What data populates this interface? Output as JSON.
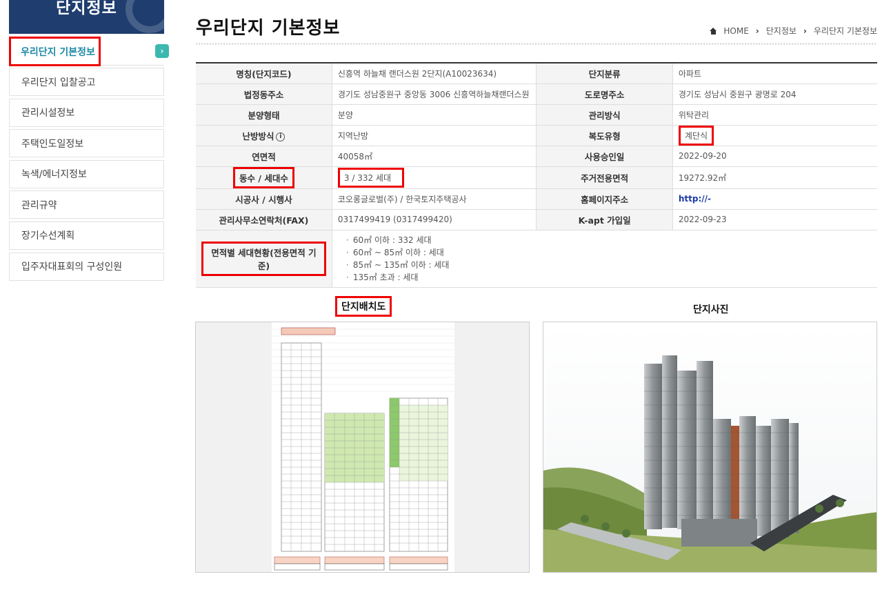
{
  "sidebar": {
    "header": "단지정보",
    "items": [
      {
        "label": "우리단지 기본정보",
        "active": true
      },
      {
        "label": "우리단지 입찰공고"
      },
      {
        "label": "관리시설정보"
      },
      {
        "label": "주택인도일정보"
      },
      {
        "label": "녹색/에너지정보"
      },
      {
        "label": "관리규약"
      },
      {
        "label": "장기수선계획"
      },
      {
        "label": "입주자대표회의 구성인원"
      }
    ],
    "badge": "›"
  },
  "page": {
    "title": "우리단지 기본정보",
    "breadcrumb": [
      "HOME",
      "단지정보",
      "우리단지 기본정보"
    ]
  },
  "table": {
    "rows": [
      {
        "l_label": "명칭(단지코드)",
        "l_value": "신흥역 하늘채 랜더스원 2단지(A10023634)",
        "r_label": "단지분류",
        "r_value": "아파트"
      },
      {
        "l_label": "법정동주소",
        "l_value": "경기도 성남중원구 중앙동 3006 신흥역하늘채랜더스원",
        "r_label": "도로명주소",
        "r_value": "경기도 성남시 중원구 광명로 204"
      },
      {
        "l_label": "분양형태",
        "l_value": "분양",
        "r_label": "관리방식",
        "r_value": "위탁관리"
      },
      {
        "l_label": "난방방식",
        "l_value": "지역난방",
        "r_label": "복도유형",
        "r_value": "계단식"
      },
      {
        "l_label": "연면적",
        "l_value": "40058㎡",
        "r_label": "사용승인일",
        "r_value": "2022-09-20"
      },
      {
        "l_label": "동수 / 세대수",
        "l_value": "3 / 332 세대",
        "r_label": "주거전용면적",
        "r_value": "19272.92㎡"
      },
      {
        "l_label": "시공사 / 시행사",
        "l_value": "코오롱글로벌(주) / 한국토지주택공사",
        "r_label": "홈페이지주소",
        "r_value": "http://-"
      },
      {
        "l_label": "관리사무소연락처(FAX)",
        "l_value": "0317499419 (0317499420)",
        "r_label": "K-apt 가입일",
        "r_value": "2022-09-23"
      }
    ],
    "area_label": "면적별 세대현황(전용면적 기준)",
    "areas": [
      "60㎡ 이하 : 332 세대",
      "60㎡ ~ 85㎡ 이하 : 세대",
      "85㎡ ~ 135㎡ 이하 : 세대",
      "135㎡ 초과 : 세대"
    ],
    "info_icon": "i"
  },
  "images": {
    "left_title": "단지배치도",
    "right_title": "단지사진"
  },
  "colors": {
    "sidebar_header": "#1f3d6e",
    "active_text": "#1d8aa5",
    "highlight": "#e00000",
    "link": "#1b3aa6"
  }
}
